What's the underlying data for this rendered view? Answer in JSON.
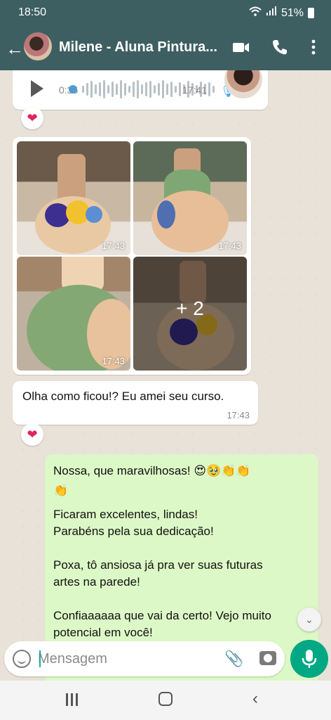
{
  "status_bar": {
    "time": "18:50",
    "battery": "51%"
  },
  "header": {
    "title": "Milene - Aluna Pintura...",
    "back_icon": "arrow-left-icon",
    "video_icon": "video-camera-icon",
    "call_icon": "phone-icon",
    "menu_icon": "more-vert-icon"
  },
  "audio_message": {
    "duration": "0:35",
    "time": "17:41",
    "reaction": "❤"
  },
  "image_group": {
    "tiles": [
      {
        "time": "17:43"
      },
      {
        "time": "17:43"
      },
      {
        "time": "17:43"
      },
      {
        "more": "+ 2"
      }
    ],
    "reaction": "❤"
  },
  "incoming_text": {
    "text": "Olha como ficou!? Eu amei seu curso.",
    "time": "17:43",
    "reaction": "❤"
  },
  "outgoing_text": {
    "line1": "Nossa, que maravilhosas! 😍🥹👏👏",
    "line2": "👏",
    "line3": "Ficaram excelentes, lindas!",
    "line4": "Parabéns pela sua dedicação!",
    "line5": "Poxa, tô ansiosa já pra ver suas futuras",
    "line6": "artes na parede!",
    "line7": "Confiaaaaaa que vai da certo! Vejo muito",
    "line8": "potencial em você!"
  },
  "composer": {
    "placeholder": "Mensagem"
  }
}
